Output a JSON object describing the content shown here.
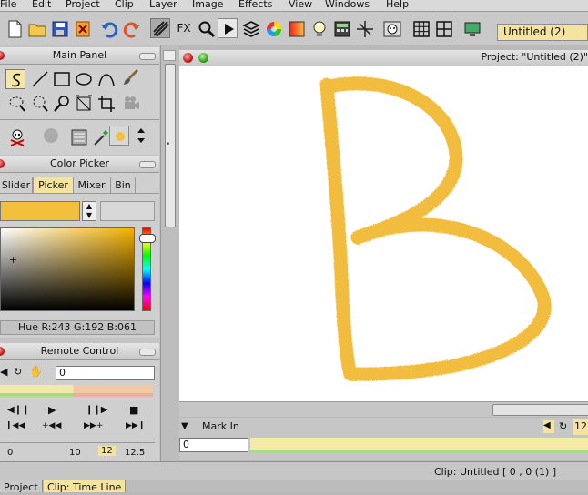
{
  "menu": [
    "File",
    "Edit",
    "Project",
    "Clip",
    "Layer",
    "Image",
    "Effects",
    "View",
    "Windows",
    "Help"
  ],
  "toolbar": {
    "icons": [
      "new-document-icon",
      "open-folder-icon",
      "save-icon",
      "close-file-icon",
      "undo-icon",
      "redo-icon",
      "brush-strokes-icon",
      "fx-icon",
      "magnifier-icon",
      "play-icon",
      "layers-icon",
      "color-wheel-icon",
      "gradient-icon",
      "lightbulb-icon",
      "calculator-icon",
      "crosshair-icon",
      "mask-icon",
      "grid-icon",
      "grid-split-icon",
      "monitor-icon"
    ],
    "fx_label": "FX",
    "project_select": "Untitled (2)"
  },
  "main_panel": {
    "title": "Main Panel",
    "tools": [
      "freehand-tool-icon",
      "line-tool-icon",
      "rectangle-tool-icon",
      "ellipse-tool-icon",
      "bezier-tool-icon",
      "paint-brush-icon",
      "lasso-select-icon",
      "magic-select-icon",
      "zoom-tool-icon",
      "transform-tool-icon",
      "crop-tool-icon",
      "film-camera-icon"
    ],
    "tools2": [
      "skull-crossbones-icon",
      "stamp-icon",
      "gradient-fill-icon",
      "eyedropper-icon",
      "color-dot-icon",
      "arrows-icon"
    ]
  },
  "color_picker": {
    "title": "Color Picker",
    "tabs": [
      "Slider",
      "Picker",
      "Mixer",
      "Bin"
    ],
    "active_tab": "Picker",
    "current_color": "#f3c03d",
    "hue_text": "Hue R:243 G:192 B:061"
  },
  "remote_control": {
    "title": "Remote Control",
    "frame_value": "0",
    "scale": [
      "0",
      "10",
      "12",
      "12.5"
    ]
  },
  "canvas": {
    "project_label": "Project:  \"Untitled (2)\"",
    "stroke_color": "#f2b935"
  },
  "timeline": {
    "mark_in_label": "Mark In",
    "frame_value": "0",
    "right_value": "12"
  },
  "status": {
    "clip_text": "Clip: Untitled [ 0 , 0  (1) ]"
  },
  "bottom_tabs": [
    "Project",
    "Clip: Time Line"
  ]
}
